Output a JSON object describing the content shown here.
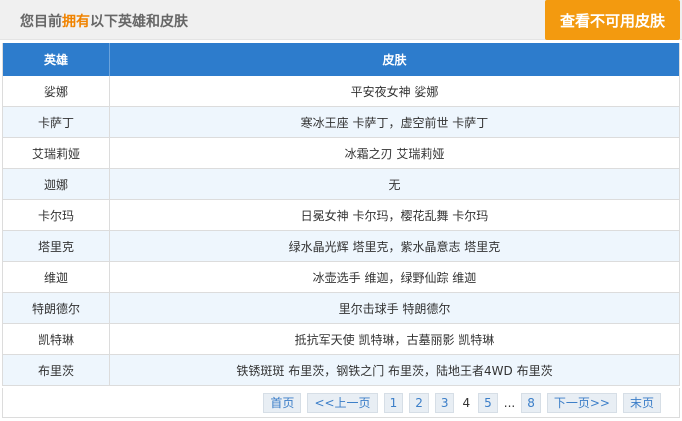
{
  "header": {
    "title_prefix": "您目前",
    "title_highlight": "拥有",
    "title_suffix": "以下英雄和皮肤",
    "unavailable_button": "查看不可用皮肤"
  },
  "table": {
    "columns": [
      "英雄",
      "皮肤"
    ],
    "rows": [
      {
        "hero": "娑娜",
        "skins": "平安夜女神 娑娜"
      },
      {
        "hero": "卡萨丁",
        "skins": "寒冰王座 卡萨丁，虚空前世 卡萨丁"
      },
      {
        "hero": "艾瑞莉娅",
        "skins": "冰霜之刃 艾瑞莉娅"
      },
      {
        "hero": "迦娜",
        "skins": "无"
      },
      {
        "hero": "卡尔玛",
        "skins": "日冕女神 卡尔玛，樱花乱舞 卡尔玛"
      },
      {
        "hero": "塔里克",
        "skins": "绿水晶光辉 塔里克，紫水晶意志 塔里克"
      },
      {
        "hero": "维迦",
        "skins": "冰壶选手 维迦，绿野仙踪 维迦"
      },
      {
        "hero": "特朗德尔",
        "skins": "里尔击球手 特朗德尔"
      },
      {
        "hero": "凯特琳",
        "skins": "抵抗军天使 凯特琳，古墓丽影 凯特琳"
      },
      {
        "hero": "布里茨",
        "skins": "铁锈斑斑 布里茨，钢铁之门 布里茨，陆地王者4WD 布里茨"
      }
    ]
  },
  "pagination": {
    "first": "首页",
    "prev": "<<上一页",
    "pages_before": [
      "1",
      "2",
      "3"
    ],
    "current": "4",
    "pages_after": [
      "5"
    ],
    "ellipsis": "...",
    "last_page": "8",
    "next": "下一页>>",
    "end": "末页"
  }
}
